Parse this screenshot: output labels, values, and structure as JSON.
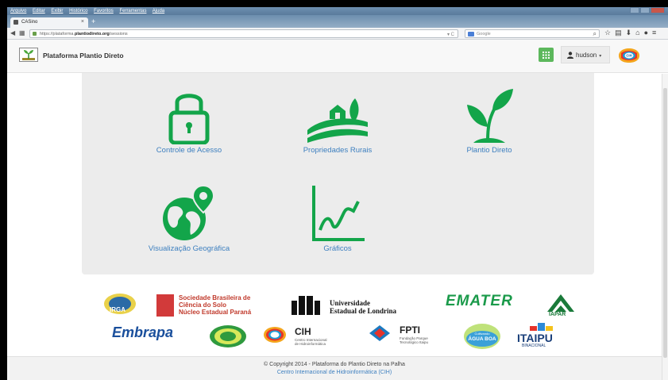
{
  "browser": {
    "menu": [
      "Arquivo",
      "Editar",
      "Exibir",
      "Histórico",
      "Favoritos",
      "Ferramentas",
      "Ajuda"
    ],
    "tab_title": "CASino",
    "new_tab": "+",
    "url_prefix": "https://plataforma.",
    "url_domain": "plantiodireto.org",
    "url_path": "/sessions",
    "url_controls": "▾ C",
    "search_placeholder": "Google"
  },
  "header": {
    "title": "Plataforma Plantio Direto",
    "user": "hudson",
    "user_caret": "▾",
    "cih_label": "CIH"
  },
  "tiles": [
    {
      "label": "Controle de Acesso",
      "icon": "lock-icon"
    },
    {
      "label": "Propriedades Rurais",
      "icon": "farm-icon"
    },
    {
      "label": "Plantio Direto",
      "icon": "sprout-icon"
    },
    {
      "label": "Visualização Geográfica",
      "icon": "globe-pin-icon"
    },
    {
      "label": "Gráficos",
      "icon": "line-chart-icon"
    }
  ],
  "partners": {
    "irga": "IRGA",
    "sbcs_line1": "Sociedade Brasileira de",
    "sbcs_line2": "Ciência do Solo",
    "sbcs_line3": "Núcleo Estadual Paraná",
    "uel_line1": "Universidade",
    "uel_line2": "Estadual de Londrina",
    "emater": "EMATER",
    "iapar": "IAPAR",
    "embrapa": "Embrapa",
    "cih_name": "CIH",
    "cih_sub1": "Centro Internacional",
    "cih_sub2": "de Hidroinformática",
    "fpti_name": "FPTI",
    "fpti_sub1": "Fundação Parque",
    "fpti_sub2": "Tecnológico Itaipu",
    "agua_boa_line1": "Cultivando",
    "agua_boa_line2": "ÁGUA BOA",
    "itaipu_name": "ITAIPU",
    "itaipu_sub": "BINACIONAL"
  },
  "footer": {
    "copyright": "© Copyright 2014 - Plataforma do Plantio Direto na Palha",
    "cih_link": "Centro Internacional de Hidroinformática (CIH)"
  },
  "colors": {
    "accent_green": "#13a54a",
    "link_blue": "#3d7fbf",
    "apps_button": "#5cb85c",
    "panel_bg": "#ececec"
  }
}
